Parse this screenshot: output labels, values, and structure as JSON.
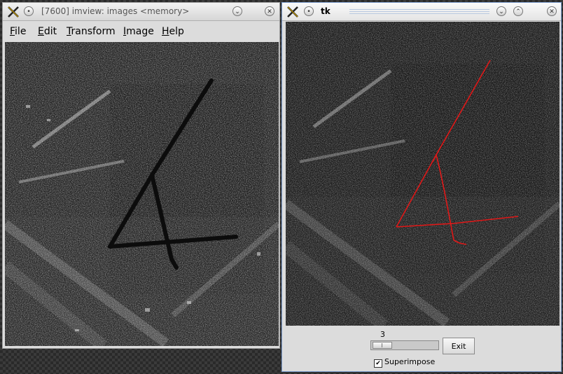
{
  "window_left": {
    "title": "[7600] imview: images <memory>",
    "menu": [
      {
        "first": "F",
        "rest": "ile"
      },
      {
        "first": "E",
        "rest": "dit"
      },
      {
        "first": "T",
        "rest": "ransform"
      },
      {
        "first": "I",
        "rest": "mage"
      },
      {
        "first": "H",
        "rest": "elp"
      }
    ]
  },
  "window_right": {
    "title": "tk",
    "scale_value": "3",
    "scale_fraction": 0.0,
    "exit_label": "Exit",
    "superimpose_label": "Superimpose",
    "superimpose_checked": true
  },
  "colors": {
    "overlay_line": "#e01818"
  },
  "icons": [
    "x-logo-icon",
    "menu-icon",
    "minimize-icon",
    "maximize-icon",
    "close-icon"
  ]
}
